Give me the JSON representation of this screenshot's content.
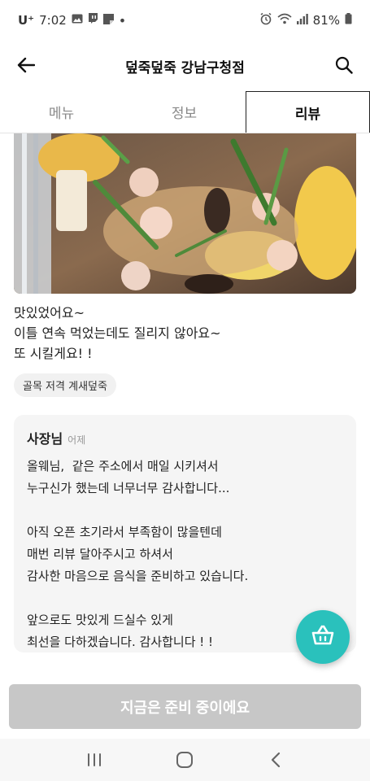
{
  "status_bar": {
    "carrier": "U⁺",
    "time": "7:02",
    "battery": "81%",
    "icons": [
      "gallery-icon",
      "twitch-icon",
      "note-icon",
      "dot-icon",
      "alarm-icon",
      "wifi-icon",
      "signal-icon",
      "battery-icon"
    ]
  },
  "header": {
    "title": "덮죽덮죽 강남구청점",
    "back_icon": "back-arrow-icon",
    "search_icon": "search-icon"
  },
  "tabs": [
    {
      "label": "메뉴",
      "active": false
    },
    {
      "label": "정보",
      "active": false
    },
    {
      "label": "리뷰",
      "active": true
    }
  ],
  "review": {
    "photo": "food-photo",
    "text_lines": [
      "맛있었어요~",
      "이틀 연속 먹었는데도 질리지 않아요~",
      "또 시킬게요! !"
    ],
    "menu_tag": "골목 저격 계새덮죽"
  },
  "owner_reply": {
    "name": "사장님",
    "date": "어제",
    "lines": [
      "올웨님,  같은 주소에서 매일 시키셔서",
      "누구신가 했는데 너무너무 감사합니다...",
      "",
      "아직 오픈 초기라서 부족함이 많을텐데",
      "매번 리뷰 달아주시고 하셔서",
      "감사한 마음으로 음식을 준비하고 있습니다.",
      "",
      "앞으로도 맛있게 드실수 있게",
      "최선을 다하겠습니다. 감사합니다 ! !"
    ]
  },
  "cart_button": {
    "icon": "basket-icon",
    "color": "#2ac1bc"
  },
  "order_button": {
    "label": "지금은 준비 중이에요",
    "color": "#c7c7c7"
  },
  "nav_bar": {
    "icons": [
      "recent-apps-icon",
      "home-icon",
      "back-icon"
    ]
  }
}
